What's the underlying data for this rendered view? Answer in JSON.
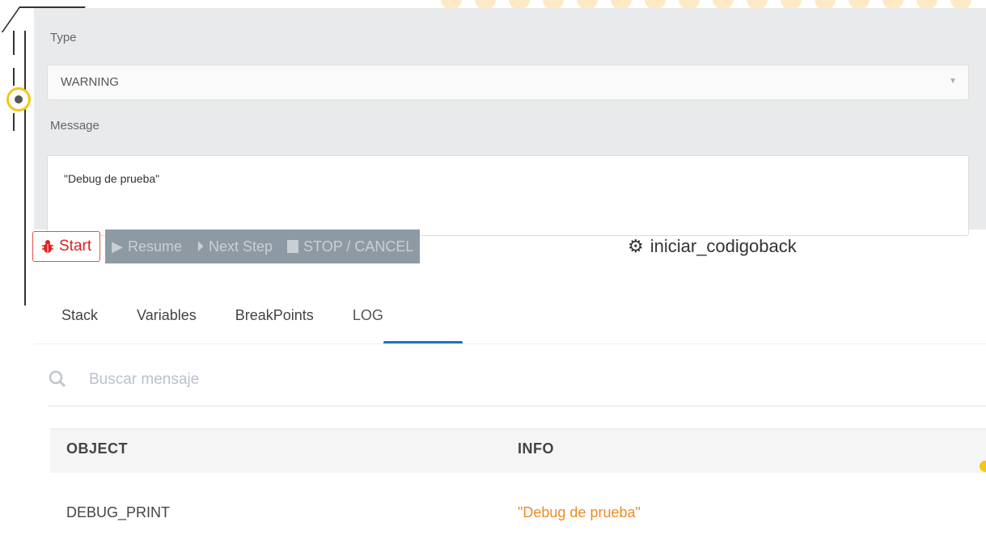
{
  "properties": {
    "type_label": "Type",
    "type_value": "WARNING",
    "message_label": "Message",
    "message_value": "\"Debug de prueba\""
  },
  "toolbar": {
    "start_label": "Start",
    "resume_label": "Resume",
    "next_step_label": "Next Step",
    "stop_label": "STOP / CANCEL",
    "process_name": "iniciar_codigoback"
  },
  "tabs": [
    {
      "label": "Stack"
    },
    {
      "label": "Variables"
    },
    {
      "label": "BreakPoints"
    },
    {
      "label": "LOG",
      "active": true
    }
  ],
  "search": {
    "placeholder": "Buscar mensaje"
  },
  "log_table": {
    "columns": [
      "OBJECT",
      "INFO"
    ],
    "rows": [
      {
        "object": "DEBUG_PRINT",
        "info": "\"Debug de prueba\""
      }
    ]
  },
  "colors": {
    "accent": "#1a73c8",
    "start_red": "#d22222",
    "info_orange": "#f08a24",
    "disabled_group": "#8e9aa3"
  }
}
